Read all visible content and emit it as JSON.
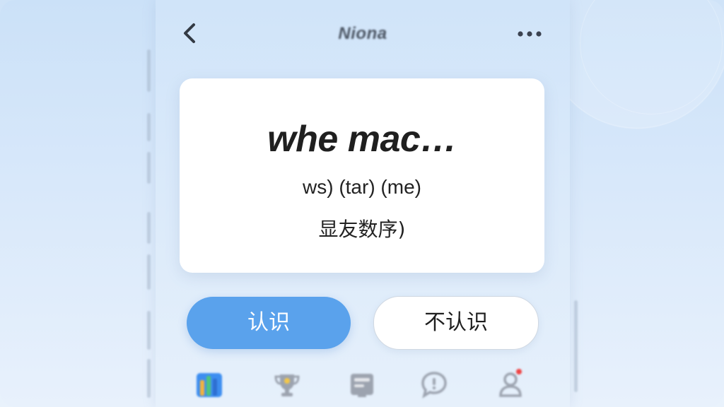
{
  "header": {
    "title": "Niona",
    "back_icon": "chevron-left-icon",
    "more_icon": "more-dots-icon"
  },
  "card": {
    "word": "whe mac…",
    "phonetic": "ws) (tar) (me)",
    "meaning": "显友数序)"
  },
  "actions": {
    "know_label": "认识",
    "unknown_label": "不认识"
  },
  "tabbar": {
    "items": [
      {
        "icon": "books-icon"
      },
      {
        "icon": "trophy-icon"
      },
      {
        "icon": "flashcard-icon"
      },
      {
        "icon": "chat-icon"
      },
      {
        "icon": "profile-icon",
        "has_badge": true
      }
    ]
  },
  "colors": {
    "accent": "#5aa2ec",
    "background": "#d0e4f9",
    "card": "#ffffff",
    "badge": "#ef4444"
  }
}
